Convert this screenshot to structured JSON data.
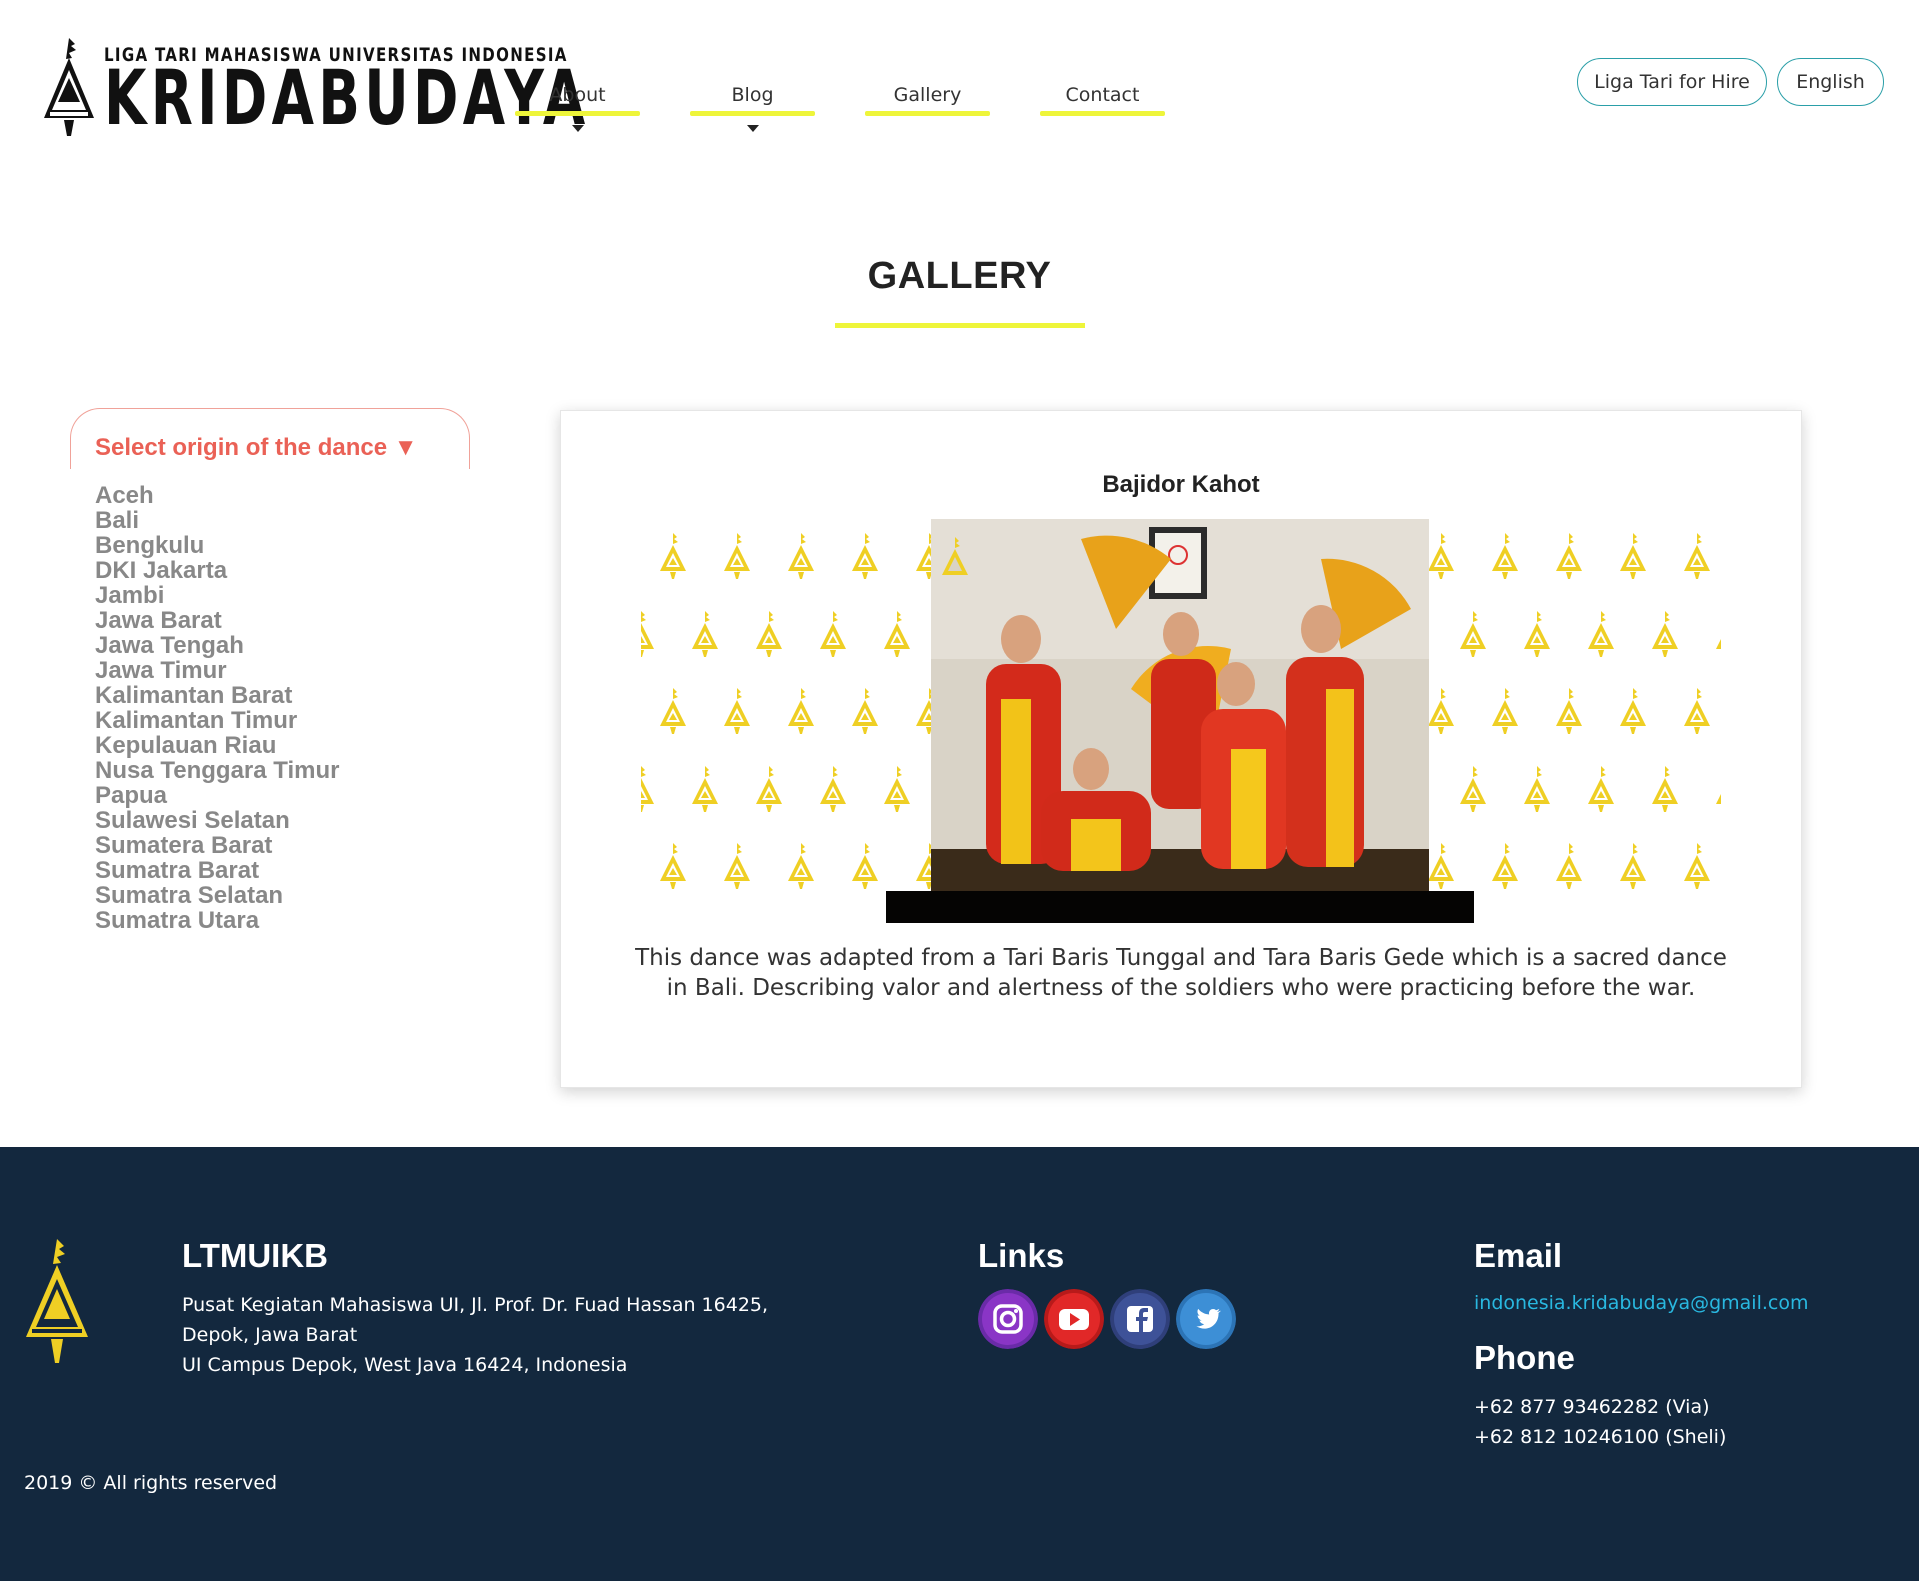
{
  "header": {
    "logo_small": "LIGA TARI MAHASISWA UNIVERSITAS INDONESIA",
    "logo_big": "KRIDABUDAYA",
    "nav": [
      {
        "label": "About",
        "has_dropdown": true
      },
      {
        "label": "Blog",
        "has_dropdown": true
      },
      {
        "label": "Gallery",
        "has_dropdown": false
      },
      {
        "label": "Contact",
        "has_dropdown": false
      }
    ],
    "hire_label": "Liga Tari for Hire",
    "language_label": "English"
  },
  "page_title": "GALLERY",
  "sidebar": {
    "select_label": "Select origin of the dance ▼",
    "regions": [
      "Aceh",
      "Bali",
      "Bengkulu",
      "DKI Jakarta",
      "Jambi",
      "Jawa Barat",
      "Jawa Tengah",
      "Jawa Timur",
      "Kalimantan Barat",
      "Kalimantan Timur",
      "Kepulauan Riau",
      "Nusa Tenggara Timur",
      "Papua",
      "Sulawesi Selatan",
      "Sumatera Barat",
      "Sumatra Barat",
      "Sumatra Selatan",
      "Sumatra Utara"
    ]
  },
  "card": {
    "title": "Bajidor Kahot",
    "description": "This dance was adapted from a Tari Baris Tunggal and Tara Baris Gede which is a sacred dance in Bali. Describing valor and alertness of the soldiers who were practicing before the war."
  },
  "footer": {
    "org_name": "LTMUIKB",
    "address": [
      "Pusat Kegiatan Mahasiswa UI, Jl. Prof. Dr. Fuad Hassan 16425,",
      "Depok, Jawa Barat",
      "UI Campus Depok, West Java 16424, Indonesia"
    ],
    "links_heading": "Links",
    "socials": [
      "instagram-icon",
      "youtube-icon",
      "facebook-icon",
      "twitter-icon"
    ],
    "email_heading": "Email",
    "email": "indonesia.kridabudaya@gmail.com",
    "phone_heading": "Phone",
    "phones": [
      "+62 877 93462282 (Via)",
      "+62 812 10246100 (Sheli)"
    ],
    "copyright": "2019 © All rights reserved"
  },
  "colors": {
    "accent_yellow": "#eef53a",
    "select_red": "#ea6156",
    "footer_bg": "#13283e",
    "link_blue": "#29b8e0",
    "pill_border": "#2a9fa8"
  }
}
